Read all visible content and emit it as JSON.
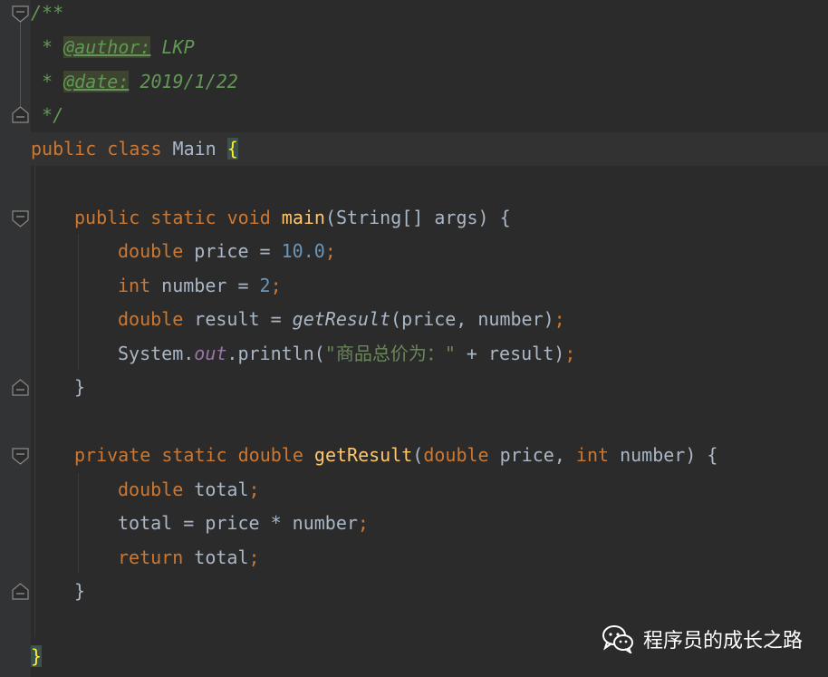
{
  "editor": {
    "lines": {
      "l1": "/**",
      "l2_star": " * ",
      "l2_tag": "@author:",
      "l2_val": " LKP",
      "l3_star": " * ",
      "l3_tag": "@date:",
      "l3_val": " 2019/1/22",
      "l4": " */",
      "l5_kw": "public class",
      "l5_name": " Main ",
      "l5_brace": "{",
      "l7_kw": "public static void",
      "l7_fn": "main",
      "l7_rest": "(String[] args) {",
      "l8_kw": "double",
      "l8_mid": " price = ",
      "l8_num": "10.0",
      "l8_end": ";",
      "l9_kw": "int",
      "l9_mid": " number = ",
      "l9_num": "2",
      "l9_end": ";",
      "l10_kw": "double",
      "l10_mid": " result = ",
      "l10_call": "getResult",
      "l10_rest": "(price, number)",
      "l10_end": ";",
      "l11_a": "System.",
      "l11_out": "out",
      "l11_b": ".println(",
      "l11_str": "\"商品总价为：\"",
      "l11_c": " + result)",
      "l11_end": ";",
      "l12": "}",
      "l14_kw": "private static double",
      "l14_fn": "getResult",
      "l14_p1": "(",
      "l14_kw2": "double",
      "l14_p2": " price, ",
      "l14_kw3": "int",
      "l14_p3": " number) {",
      "l15_kw": "double",
      "l15_rest": " total",
      "l15_end": ";",
      "l16_rest": "total = price * number",
      "l16_end": ";",
      "l17_kw": "return",
      "l17_rest": " total",
      "l17_end": ";",
      "l18": "}",
      "l20": "}"
    }
  },
  "watermark": {
    "text": "程序员的成长之路",
    "icon": "wechat-icon"
  },
  "colors": {
    "background": "#2b2b2b",
    "keyword": "#cc7832",
    "comment": "#629755",
    "number": "#6897bb",
    "function": "#ffc66d",
    "field": "#9876aa",
    "string": "#6a8759",
    "text": "#a9b7c6"
  }
}
